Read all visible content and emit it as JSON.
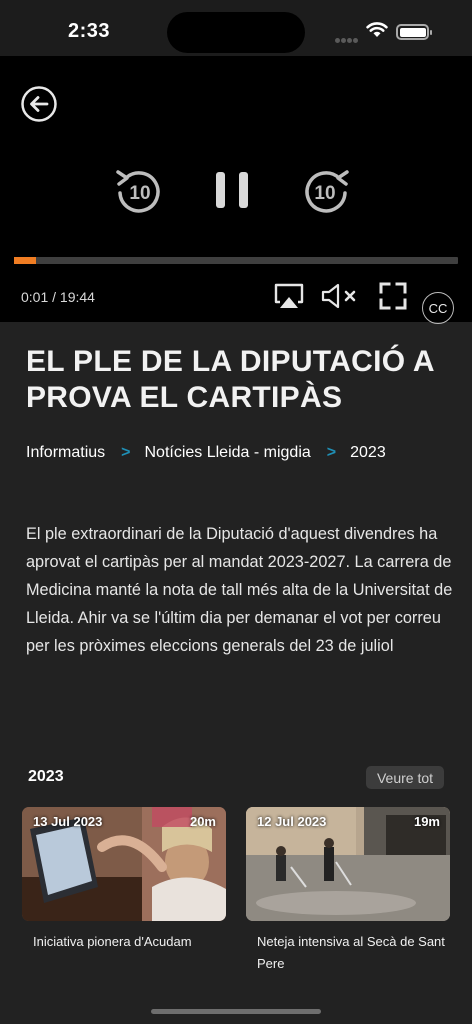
{
  "status_bar": {
    "time": "2:33"
  },
  "player": {
    "time_readout": "0:01 / 19:44",
    "progress": 0.05,
    "rewind_seconds": "10",
    "forward_seconds": "10",
    "cc_label": "CC",
    "accent_color": "#f07d23"
  },
  "article": {
    "title": "EL PLE DE LA DIPUTACIÓ A PROVA EL CARTIPÀS",
    "breadcrumb": [
      "Informatius",
      "Notícies Lleida - migdia",
      "2023"
    ],
    "breadcrumb_separator": ">",
    "description": "El ple extraordinari de la Diputació d'aquest divendres ha aprovat el cartipàs per al mandat 2023-2027. La carrera de Medicina manté la nota de tall més alta de la Universitat de Lleida. Ahir va se l'últim dia per demanar el vot per correu per les pròximes eleccions generals del 23 de juliol"
  },
  "related": {
    "section_title": "2023",
    "see_all_label": "Veure tot",
    "items": [
      {
        "date": "13 Jul 2023",
        "duration": "20m",
        "title": "Iniciativa pionera d'Acudam"
      },
      {
        "date": "12 Jul 2023",
        "duration": "19m",
        "title": "Neteja intensiva al Secà de Sant Pere"
      }
    ]
  }
}
